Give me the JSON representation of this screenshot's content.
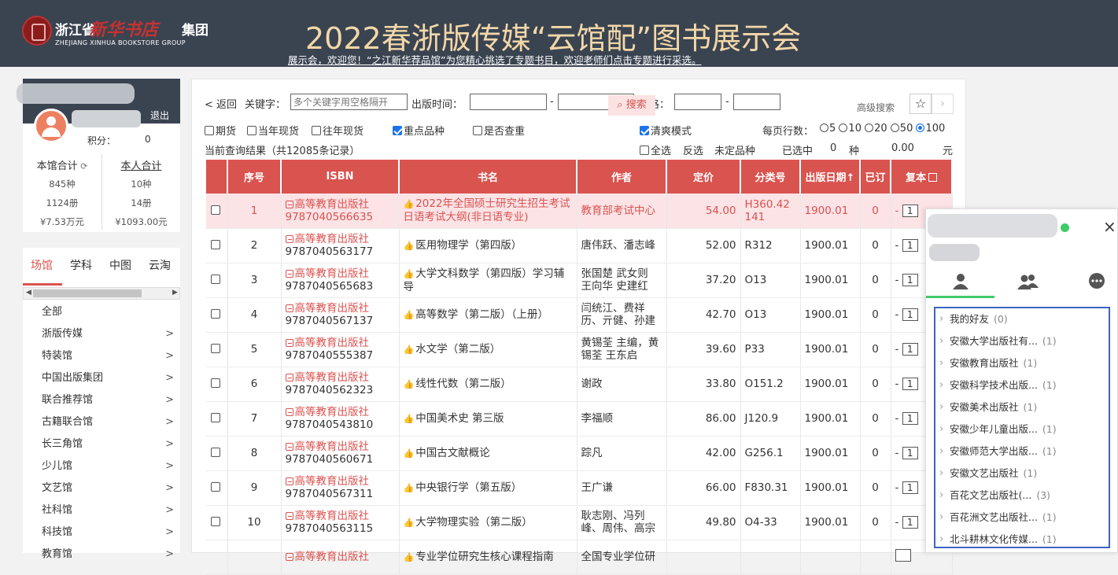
{
  "header": {
    "logo": {
      "cn_left": "浙江省",
      "cn_script": "新华书店",
      "cn_right": "集团",
      "en": "ZHEJIANG XINHUA BOOKSTORE GROUP"
    },
    "banner_title": "2022春浙版传媒“云馆配”图书展示会",
    "notice": "展示会，欢迎您！“之江新华荐品馆”为您精心挑选了专题书目，欢迎老师们点击专题进行采选。"
  },
  "user": {
    "logout": "退出",
    "points_label": "积分：",
    "points_value": "0",
    "library_total_label": "本馆合计",
    "personal_total_label": "本人合计",
    "library": {
      "kinds": "845种",
      "copies": "1124册",
      "amount": "¥7.53万元"
    },
    "personal": {
      "kinds": "10种",
      "copies": "14册",
      "amount": "¥1093.00元"
    }
  },
  "nav": {
    "tabs": [
      "场馆",
      "学科",
      "中图",
      "云淘"
    ],
    "items": [
      {
        "label": "全部",
        "arrow": ""
      },
      {
        "label": "浙版传媒",
        "arrow": ">"
      },
      {
        "label": "特装馆",
        "arrow": ">"
      },
      {
        "label": "中国出版集团",
        "arrow": ">"
      },
      {
        "label": "联合推荐馆",
        "arrow": ">"
      },
      {
        "label": "古籍联合馆",
        "arrow": ">"
      },
      {
        "label": "长三角馆",
        "arrow": ">"
      },
      {
        "label": "少儿馆",
        "arrow": ">"
      },
      {
        "label": "文艺馆",
        "arrow": ">"
      },
      {
        "label": "社科馆",
        "arrow": ">"
      },
      {
        "label": "科技馆",
        "arrow": ">"
      },
      {
        "label": "教育馆",
        "arrow": ">"
      }
    ]
  },
  "search": {
    "back": "< 返回",
    "keyword_label": "关键字：",
    "keyword_placeholder": "多个关键字用空格隔开",
    "date_label": "出版时间：",
    "dash": "-",
    "price_label": "价格：",
    "search_button": "搜索",
    "advanced": "高级搜索",
    "star": "☆",
    "next": "›"
  },
  "filters": {
    "period": "期货",
    "current_year": "当年现货",
    "past_year": "往年现货",
    "key_items": "重点品种",
    "dup_check": "是否查重",
    "clean_mode": "清爽模式",
    "page_size_label": "每页行数：",
    "page_sizes": [
      "5",
      "10",
      "20",
      "50",
      "100"
    ],
    "result_text": "当前查询结果（共12085条记录）",
    "select_all": "全选",
    "invert": "反选",
    "undecided": "未定品种",
    "selected_label": "已选中",
    "selected_count": "0",
    "kind_unit": "种",
    "selected_amount": "0.00",
    "yuan_unit": "元"
  },
  "table": {
    "headers": [
      "序号",
      "ISBN",
      "书名",
      "作者",
      "定价",
      "分类号",
      "出版日期↑",
      "已订",
      "复本"
    ],
    "rows": [
      {
        "no": "1",
        "publisher": "高等教育出版社",
        "isbn": "9787040566635",
        "title": "2022年全国硕士研究生招生考试日语考试大纲(非日语专业)",
        "author": "教育部考试中心",
        "price": "54.00",
        "class": "H360.42141",
        "date": "1900.01",
        "ordered": "0",
        "dash": "-",
        "copies": "1"
      },
      {
        "no": "2",
        "publisher": "高等教育出版社",
        "isbn": "9787040563177",
        "title": "医用物理学（第四版）",
        "author": "唐伟跃、潘志峰",
        "price": "52.00",
        "class": "R312",
        "date": "1900.01",
        "ordered": "0",
        "dash": "-",
        "copies": "1"
      },
      {
        "no": "3",
        "publisher": "高等教育出版社",
        "isbn": "9787040565683",
        "title": "大学文科数学（第四版）学习辅导",
        "author": "张国楚 武女则 王向华 史建红",
        "price": "37.20",
        "class": "O13",
        "date": "1900.01",
        "ordered": "0",
        "dash": "-",
        "copies": "1"
      },
      {
        "no": "4",
        "publisher": "高等教育出版社",
        "isbn": "9787040567137",
        "title": "高等数学（第二版）（上册）",
        "author": "闫统江、费祥历、亓健、孙建",
        "price": "42.70",
        "class": "O13",
        "date": "1900.01",
        "ordered": "0",
        "dash": "-",
        "copies": "1"
      },
      {
        "no": "5",
        "publisher": "高等教育出版社",
        "isbn": "9787040555387",
        "title": "水文学（第二版）",
        "author": "黄锡荃 主编，黄锡荃 王东启",
        "price": "39.60",
        "class": "P33",
        "date": "1900.01",
        "ordered": "0",
        "dash": "-",
        "copies": "1"
      },
      {
        "no": "6",
        "publisher": "高等教育出版社",
        "isbn": "9787040562323",
        "title": "线性代数（第二版）",
        "author": "谢政",
        "price": "33.80",
        "class": "O151.2",
        "date": "1900.01",
        "ordered": "0",
        "dash": "-",
        "copies": "1"
      },
      {
        "no": "7",
        "publisher": "高等教育出版社",
        "isbn": "9787040543810",
        "title": "中国美术史 第三版",
        "author": "李福顺",
        "price": "86.00",
        "class": "J120.9",
        "date": "1900.01",
        "ordered": "0",
        "dash": "-",
        "copies": "1"
      },
      {
        "no": "8",
        "publisher": "高等教育出版社",
        "isbn": "9787040560671",
        "title": "中国古文献概论",
        "author": "踪凡",
        "price": "42.00",
        "class": "G256.1",
        "date": "1900.01",
        "ordered": "0",
        "dash": "-",
        "copies": "1"
      },
      {
        "no": "9",
        "publisher": "高等教育出版社",
        "isbn": "9787040567311",
        "title": "中央银行学（第五版）",
        "author": "王广谦",
        "price": "66.00",
        "class": "F830.31",
        "date": "1900.01",
        "ordered": "0",
        "dash": "-",
        "copies": "1"
      },
      {
        "no": "10",
        "publisher": "高等教育出版社",
        "isbn": "9787040563115",
        "title": "大学物理实验（第二版）",
        "author": "耿志刚、冯列峰、周伟、高宗",
        "price": "49.80",
        "class": "O4-33",
        "date": "1900.01",
        "ordered": "0",
        "dash": "-",
        "copies": "1"
      },
      {
        "no": "",
        "publisher": "高等教育出版社",
        "isbn": "",
        "title": "专业学位研究生核心课程指南",
        "author": "全国专业学位研",
        "price": "",
        "class": "",
        "date": "",
        "ordered": "",
        "dash": "",
        "copies": ""
      }
    ]
  },
  "chat": {
    "close": "×",
    "friends": [
      {
        "name": "我的好友",
        "count": "(0)"
      },
      {
        "name": "安徽大学出版社有...",
        "count": "(1)"
      },
      {
        "name": "安徽教育出版社",
        "count": "(1)"
      },
      {
        "name": "安徽科学技术出版...",
        "count": "(1)"
      },
      {
        "name": "安徽美术出版社",
        "count": "(1)"
      },
      {
        "name": "安徽少年儿童出版...",
        "count": "(1)"
      },
      {
        "name": "安徽师范大学出版...",
        "count": "(1)"
      },
      {
        "name": "安徽文艺出版社",
        "count": "(1)"
      },
      {
        "name": "百花文艺出版社(...",
        "count": "(3)"
      },
      {
        "name": "百花洲文艺出版社...",
        "count": "(1)"
      },
      {
        "name": "北斗耕林文化传媒...",
        "count": "(1)"
      }
    ]
  },
  "colors": {
    "header_bg": "#3a4451",
    "accent_red": "#d9534f",
    "banner_gold": "#f3d7a8",
    "online_green": "#3ecb6a",
    "highlight_row": "#fbe3e6",
    "list_border": "#3d63c4"
  }
}
